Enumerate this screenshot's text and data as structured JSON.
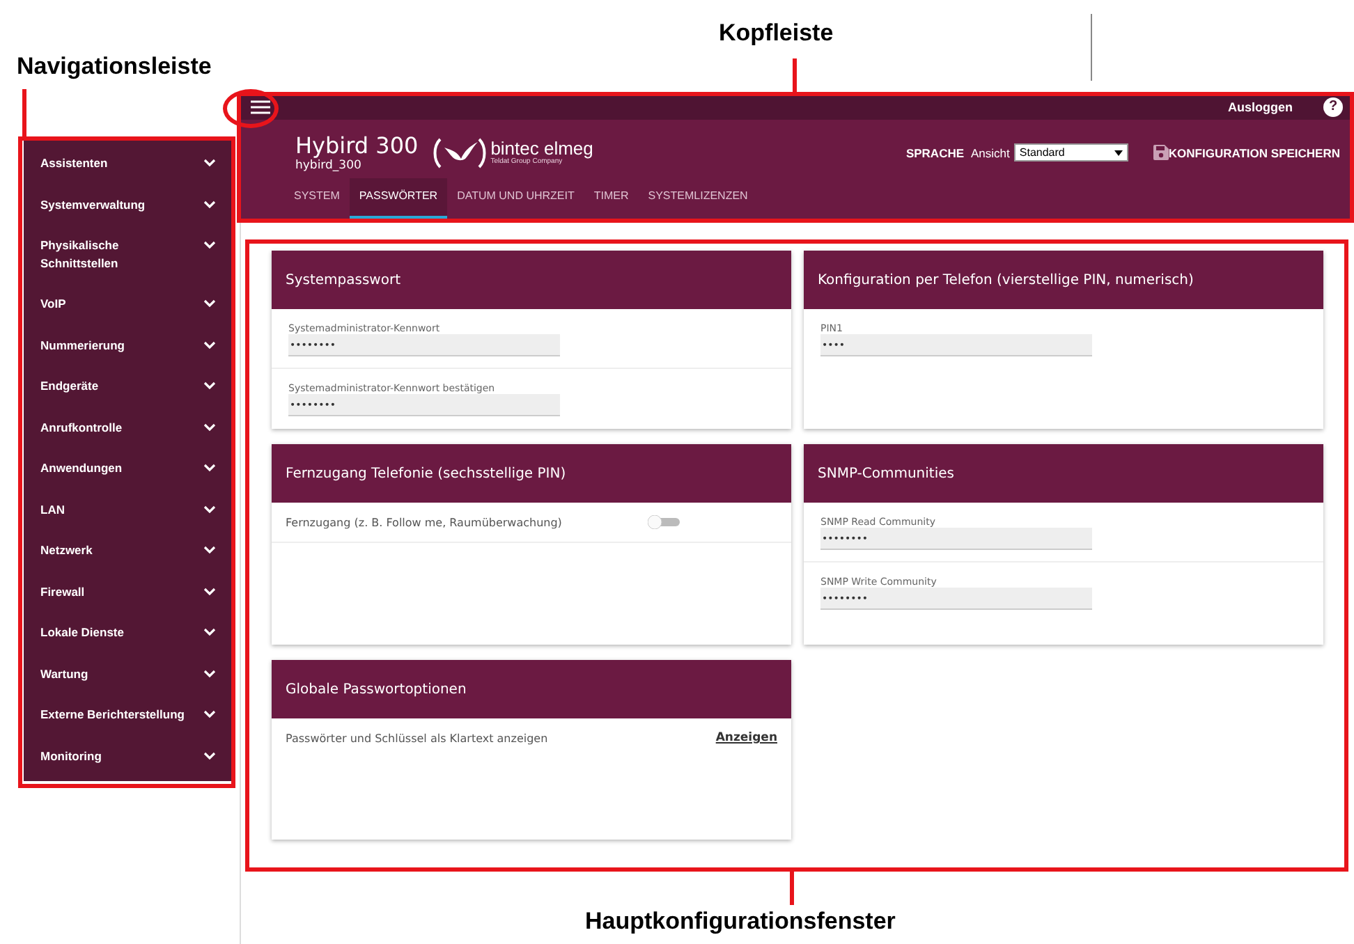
{
  "callouts": [
    {
      "kind": "header",
      "label": "Kopfleiste"
    },
    {
      "kind": "sidebar",
      "label": "Navigationsleiste"
    },
    {
      "kind": "main",
      "label": "Hauptkonfigurationsfenster"
    }
  ],
  "topbar": {
    "logout": "Ausloggen",
    "help": "?"
  },
  "device": {
    "title": "Hybird 300",
    "subtitle": "hybird_300",
    "brand": "bintec elmeg",
    "brand_tagline": "Teldat Group Company"
  },
  "language": {
    "label": "SPRACHE",
    "view_label": "Ansicht",
    "view_value": "Standard"
  },
  "save_button": "KONFIGURATION SPEICHERN",
  "tabs": [
    {
      "label": "SYSTEM",
      "selected": false
    },
    {
      "label": "PASSWÖRTER",
      "selected": true
    },
    {
      "label": "DATUM UND UHRZEIT",
      "selected": false
    },
    {
      "label": "TIMER",
      "selected": false
    },
    {
      "label": "SYSTEMLIZENZEN",
      "selected": false
    }
  ],
  "sidebar": {
    "items": [
      {
        "label": "Assistenten"
      },
      {
        "label": "Systemverwaltung"
      },
      {
        "label": "Physikalische Schnittstellen"
      },
      {
        "label": "VoIP"
      },
      {
        "label": "Nummerierung"
      },
      {
        "label": "Endgeräte"
      },
      {
        "label": "Anrufkontrolle"
      },
      {
        "label": "Anwendungen"
      },
      {
        "label": "LAN"
      },
      {
        "label": "Netzwerk"
      },
      {
        "label": "Firewall"
      },
      {
        "label": "Lokale Dienste"
      },
      {
        "label": "Wartung"
      },
      {
        "label": "Externe Berichterstellung"
      },
      {
        "label": "Monitoring"
      }
    ]
  },
  "cards": [
    {
      "title": "Systempasswort",
      "rows": [
        {
          "kind": "field",
          "label": "Systemadministrator-Kennwort",
          "value": "••••••••"
        },
        {
          "kind": "field",
          "label": "Systemadministrator-Kennwort bestätigen",
          "value": "••••••••"
        }
      ]
    },
    {
      "title": "Konfiguration per Telefon (vierstellige PIN, numerisch)",
      "rows": [
        {
          "kind": "field",
          "label": "PIN1",
          "value": "••••"
        }
      ]
    },
    {
      "title": "Fernzugang Telefonie (sechsstellige PIN)",
      "rows": [
        {
          "kind": "toggle",
          "label": "Fernzugang (z. B. Follow me, Raumüberwachung)",
          "on": false
        }
      ]
    },
    {
      "title": "SNMP-Communities",
      "rows": [
        {
          "kind": "field",
          "label": "SNMP Read Community",
          "value": "••••••••"
        },
        {
          "kind": "field",
          "label": "SNMP Write Community",
          "value": "••••••••"
        }
      ]
    },
    {
      "title": "Globale Passwortoptionen",
      "rows": [
        {
          "kind": "link",
          "label": "Passwörter und Schlüssel als Klartext anzeigen",
          "link": "Anzeigen"
        }
      ]
    }
  ]
}
